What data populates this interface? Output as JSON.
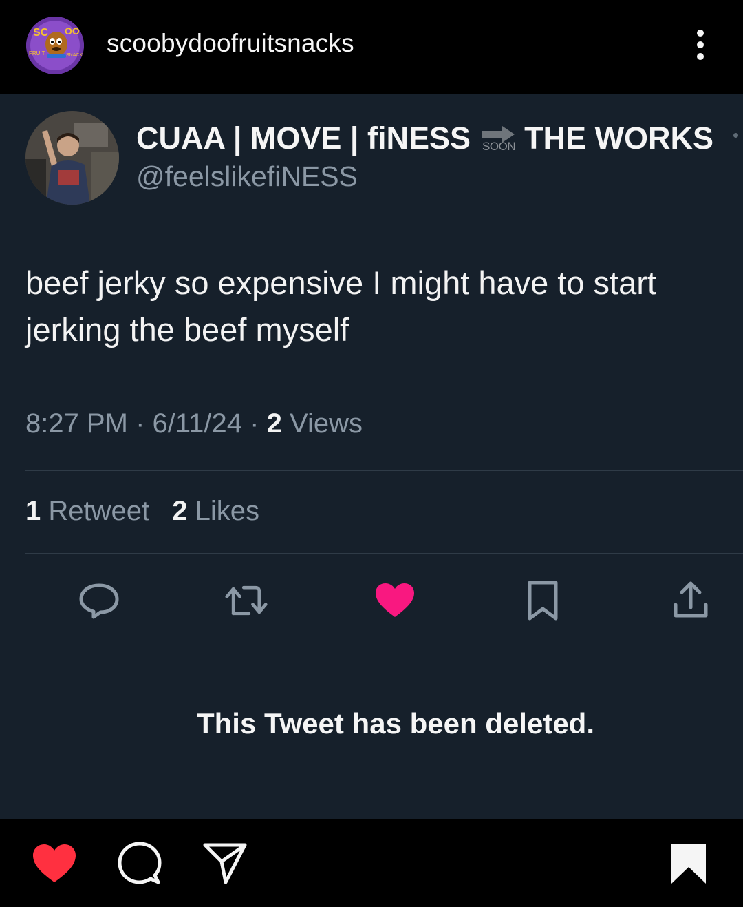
{
  "post": {
    "username": "scoobydoofruitsnacks",
    "avatar_icon": "scooby-doo-fruit-snacks-logo",
    "more_icon": "more-vertical-icon"
  },
  "tweet": {
    "display_name_left": "CUAA | MOVE | fiNESS",
    "arrow_label": "SOON",
    "display_name_right": "THE WORKS",
    "handle": "@feelslikefiNESS",
    "text": "beef jerky so expensive I might have to start jerking the beef myself",
    "time": "8:27 PM",
    "date": "6/11/24",
    "views_count": "2",
    "views_label": "Views",
    "retweets_count": "1",
    "retweets_label": "Retweet",
    "likes_count": "2",
    "likes_label": "Likes",
    "separator": "·",
    "deleted_notice": "This Tweet has been deleted.",
    "colors": {
      "background": "#16202b",
      "like_active": "#f91880",
      "muted_text": "#8b98a5"
    },
    "actions": [
      "reply-icon",
      "retweet-icon",
      "like-icon-filled",
      "bookmark-icon",
      "share-icon"
    ]
  },
  "footer": {
    "actions": [
      "heart-icon-filled",
      "comment-icon",
      "send-icon",
      "save-icon-filled"
    ],
    "like_color": "#ff3040"
  }
}
